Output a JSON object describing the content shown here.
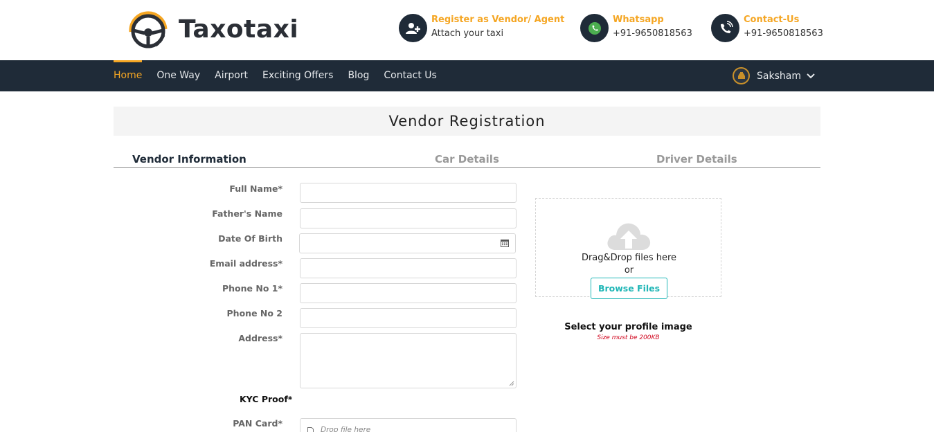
{
  "brand": {
    "name": "Taxotaxi",
    "accent": "#f5a623",
    "dark": "#1f2b38"
  },
  "header": {
    "contacts": [
      {
        "icon": "add-user-icon",
        "title": "Register as Vendor/ Agent",
        "subtitle": "Attach your taxi"
      },
      {
        "icon": "whatsapp-icon",
        "title": "Whatsapp",
        "subtitle": "+91-9650818563"
      },
      {
        "icon": "phone-icon",
        "title": "Contact-Us",
        "subtitle": "+91-9650818563"
      }
    ]
  },
  "nav": {
    "items": [
      "Home",
      "One Way",
      "Airport",
      "Exciting Offers",
      "Blog",
      "Contact Us"
    ],
    "active": "Home",
    "user": {
      "name": "Saksham",
      "icon": "taxi-avatar-icon"
    }
  },
  "page": {
    "title": "Vendor Registration"
  },
  "steps": [
    {
      "label": "Vendor Information",
      "active": true
    },
    {
      "label": "Car Details",
      "active": false
    },
    {
      "label": "Driver Details",
      "active": false
    }
  ],
  "form": {
    "full_name_label": "Full Name*",
    "full_name_value": "",
    "father_name_label": "Father's Name",
    "father_name_value": "",
    "dob_label": "Date Of Birth",
    "dob_value": "",
    "email_label": "Email address*",
    "email_value": "",
    "phone1_label": "Phone No 1*",
    "phone1_value": "",
    "phone2_label": "Phone No 2",
    "phone2_value": "",
    "address_label": "Address*",
    "address_value": "",
    "kyc_heading": "KYC Proof*",
    "pan_label": "PAN Card*",
    "pan_drop_text": "Drop file here"
  },
  "upload": {
    "drag_text": "Drag&Drop files here",
    "or_text": "or",
    "browse_label": "Browse Files",
    "caption": "Select your profile image",
    "size_note": "Size must be 200KB"
  }
}
